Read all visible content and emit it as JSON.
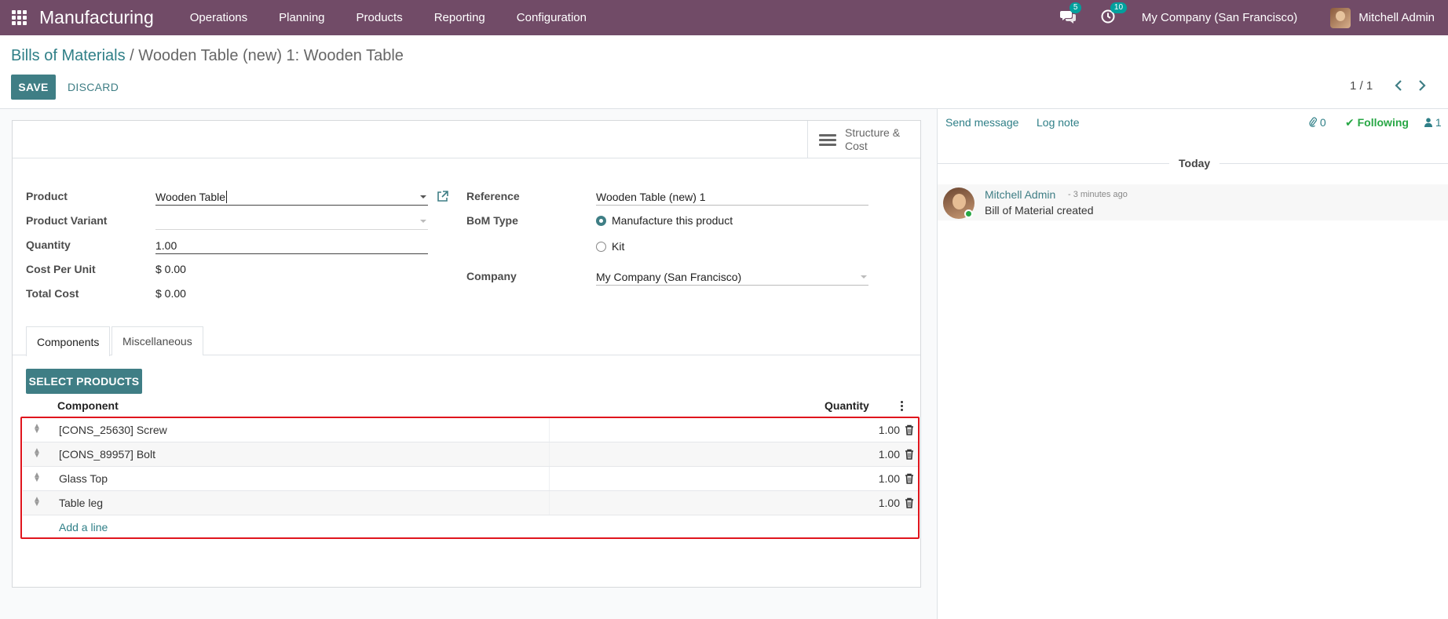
{
  "navbar": {
    "brand": "Manufacturing",
    "menu": [
      "Operations",
      "Planning",
      "Products",
      "Reporting",
      "Configuration"
    ],
    "messages_badge": "5",
    "activities_badge": "10",
    "company": "My Company (San Francisco)",
    "user": "Mitchell Admin",
    "color": "#714B67"
  },
  "control_panel": {
    "breadcrumb_parent": "Bills of Materials",
    "breadcrumb_separator": "/",
    "breadcrumb_current": "Wooden Table (new) 1: Wooden Table",
    "save_label": "SAVE",
    "discard_label": "DISCARD",
    "pager": "1 / 1"
  },
  "form": {
    "stat_button": {
      "line1": "Structure &",
      "line2": "Cost"
    },
    "left": {
      "product_label": "Product",
      "product_value": "Wooden Table",
      "variant_label": "Product Variant",
      "variant_value": "",
      "quantity_label": "Quantity",
      "quantity_value": "1.00",
      "cost_per_unit_label": "Cost Per Unit",
      "cost_per_unit_value": "$ 0.00",
      "total_cost_label": "Total Cost",
      "total_cost_value": "$ 0.00"
    },
    "right": {
      "reference_label": "Reference",
      "reference_value": "Wooden Table (new) 1",
      "bom_type_label": "BoM Type",
      "bom_type_options": [
        "Manufacture this product",
        "Kit"
      ],
      "bom_type_selected": "Manufacture this product",
      "company_label": "Company",
      "company_value": "My Company (San Francisco)"
    },
    "tabs": [
      "Components",
      "Miscellaneous"
    ],
    "active_tab": "Components",
    "select_products_label": "SELECT PRODUCTS",
    "table": {
      "headers": {
        "component": "Component",
        "quantity": "Quantity"
      },
      "rows": [
        {
          "component": "[CONS_25630] Screw",
          "quantity": "1.00"
        },
        {
          "component": "[CONS_89957] Bolt",
          "quantity": "1.00"
        },
        {
          "component": "Glass Top",
          "quantity": "1.00"
        },
        {
          "component": "Table leg",
          "quantity": "1.00"
        }
      ],
      "add_line": "Add a line"
    },
    "accent_color": "#3f7e85",
    "highlight_color": "#e0151d"
  },
  "chatter": {
    "send_message": "Send message",
    "log_note": "Log note",
    "attachments_count": "0",
    "following_label": "Following",
    "followers_count": "1",
    "date_separator": "Today",
    "message": {
      "author": "Mitchell Admin",
      "date": "- 3 minutes ago",
      "body": "Bill of Material created"
    }
  }
}
